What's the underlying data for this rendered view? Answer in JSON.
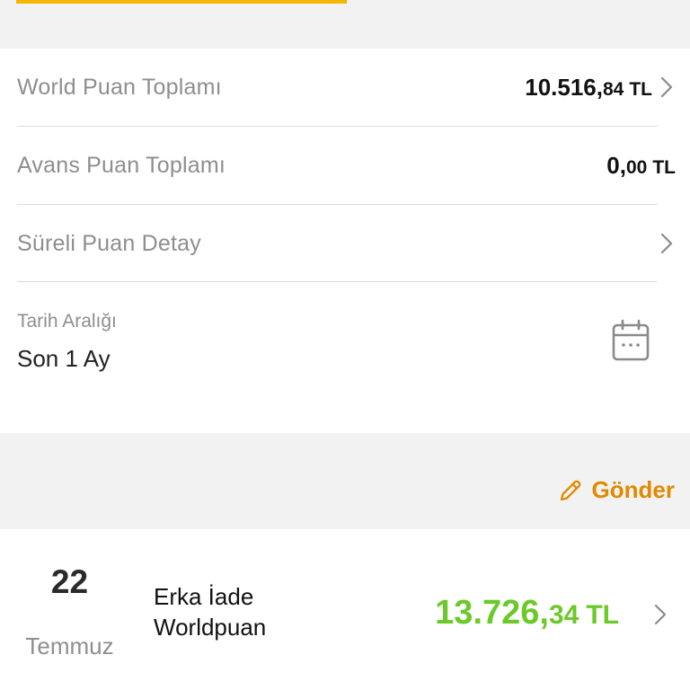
{
  "tabs": {
    "active_indicator_color": "#f7b500"
  },
  "summary": {
    "world": {
      "label": "World Puan Toplamı",
      "amount_int": "10.516,",
      "amount_dec": "84",
      "currency": "TL"
    },
    "advance": {
      "label": "Avans Puan Toplamı",
      "amount_int": "0,",
      "amount_dec": "00",
      "currency": "TL"
    },
    "timed": {
      "label": "Süreli Puan Detay"
    }
  },
  "date_range": {
    "label": "Tarih Aralığı",
    "value": "Son 1 Ay",
    "icon": "calendar-icon"
  },
  "actions": {
    "send_label": "Gönder",
    "send_icon": "pencil-icon",
    "accent_color": "#e08a00"
  },
  "transactions": [
    {
      "day": "22",
      "month": "Temmuz",
      "description_line1": "Erka İade",
      "description_line2": "Worldpuan",
      "amount_int": "13.726,",
      "amount_dec": "34",
      "currency": "TL",
      "amount_color": "#6cc92a"
    }
  ]
}
